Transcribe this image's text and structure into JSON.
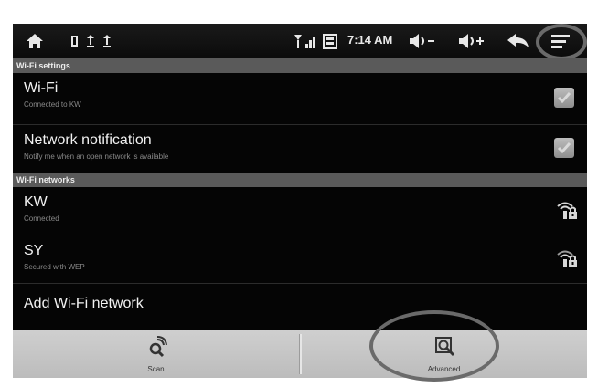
{
  "status_bar": {
    "time": "7:14 AM",
    "icons": [
      "home-icon",
      "notification-icons",
      "signal-icons",
      "volume-down-icon",
      "volume-up-icon",
      "back-icon",
      "menu-icon"
    ]
  },
  "sections": {
    "wifi_settings": "Wi-Fi settings",
    "wifi_networks": "Wi-Fi networks"
  },
  "settings": [
    {
      "title": "Wi-Fi",
      "summary": "Connected to KW",
      "checked": true
    },
    {
      "title": "Network notification",
      "summary": "Notify me when an open network is available",
      "checked": true
    }
  ],
  "networks": [
    {
      "ssid": "KW",
      "status": "Connected",
      "secured": true
    },
    {
      "ssid": "SY",
      "status": "Secured with WEP",
      "secured": true
    }
  ],
  "add_network": {
    "label": "Add Wi-Fi network"
  },
  "action_bar": {
    "scan_label": "Scan",
    "advanced_label": "Advanced"
  },
  "colors": {
    "screen_bg": "#050505",
    "header_bg": "#5a5a5a",
    "action_bar_bg": "#c6c6c6",
    "highlight_circle": "#6a6a6a"
  }
}
